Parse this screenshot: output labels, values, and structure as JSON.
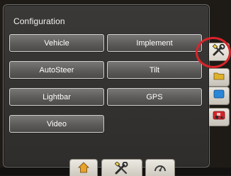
{
  "panel": {
    "title": "Configuration"
  },
  "buttons": {
    "vehicle": "Vehicle",
    "implement": "Implement",
    "autosteer": "AutoSteer",
    "tilt": "Tilt",
    "lightbar": "Lightbar",
    "gps": "GPS",
    "video": "Video"
  },
  "side_tabs": [
    {
      "icon": "wrench-screwdriver-icon",
      "selected": true
    },
    {
      "icon": "folder-icon",
      "color": "#e0b12a"
    },
    {
      "icon": "screen-icon",
      "color": "#2a86d6"
    },
    {
      "icon": "tractor-icon",
      "color": "#d3262c"
    }
  ],
  "footer_tabs": [
    {
      "icon": "home-icon"
    },
    {
      "icon": "wrench-screwdriver-icon"
    },
    {
      "icon": "gauge-icon"
    }
  ],
  "colors": {
    "accent_ring": "#d8242a",
    "panel_bg": "#3b3937"
  }
}
